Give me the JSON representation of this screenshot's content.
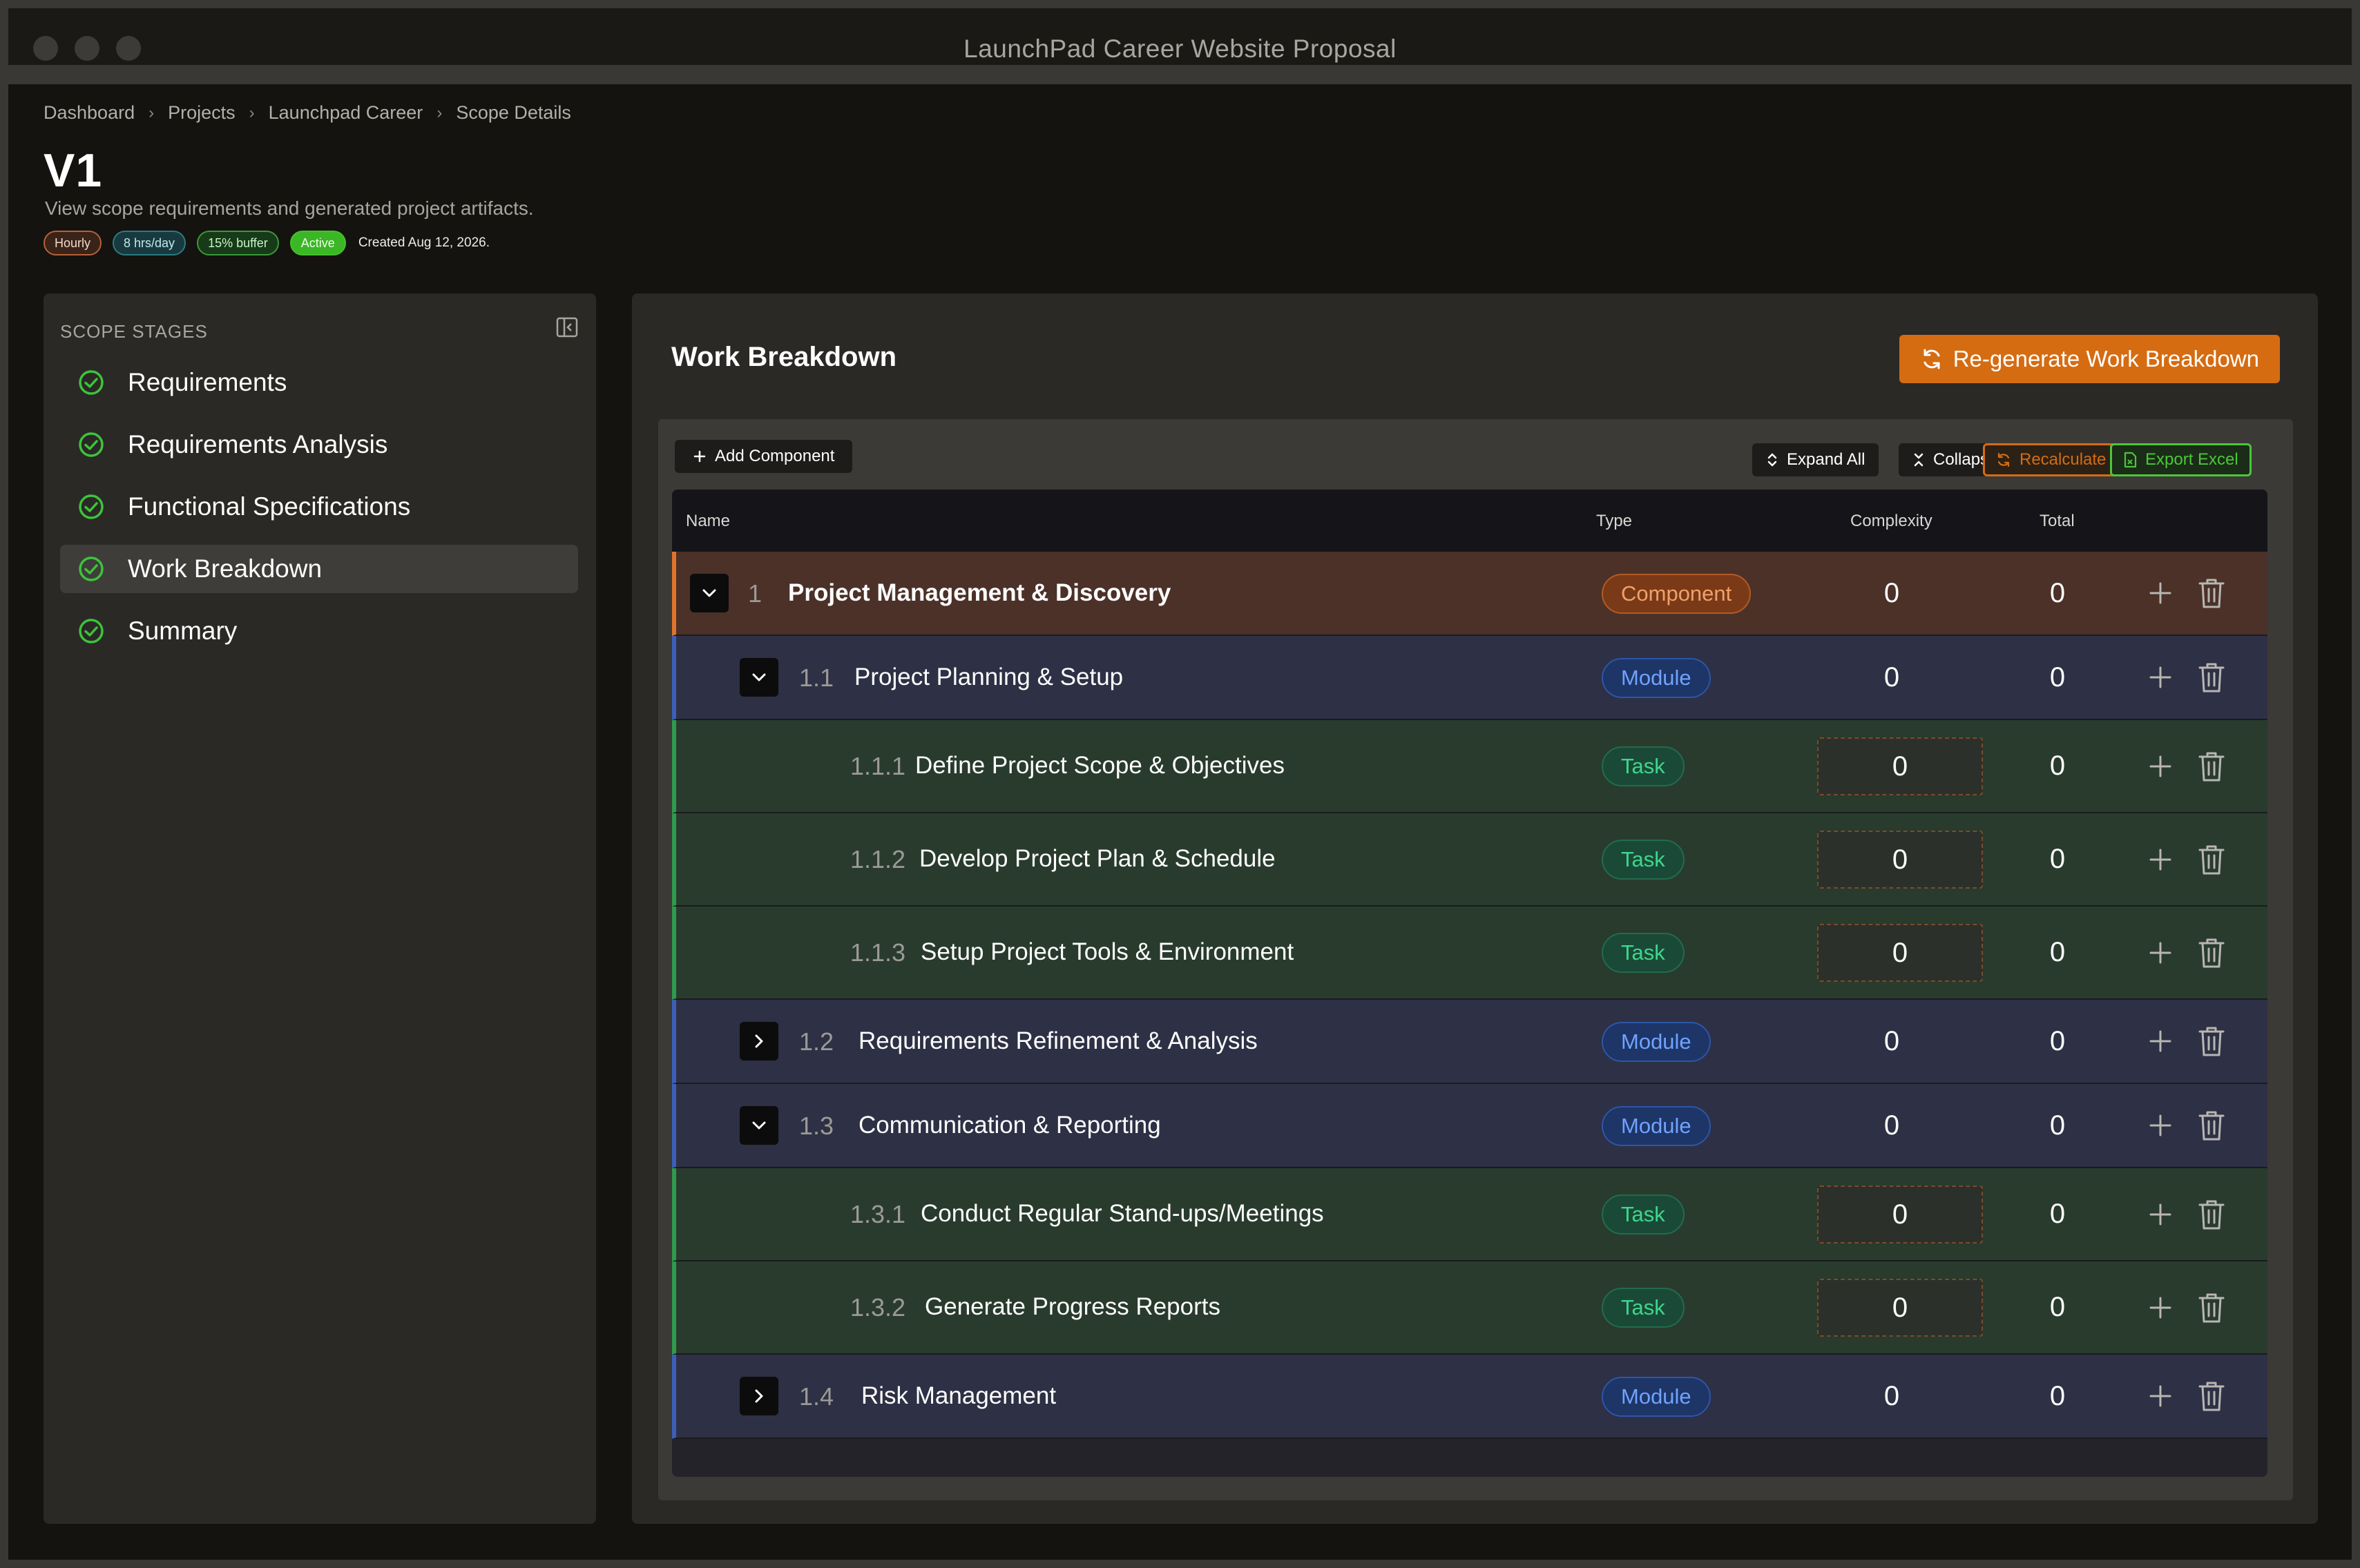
{
  "window": {
    "title": "LaunchPad Career Website Proposal"
  },
  "breadcrumb": [
    "Dashboard",
    "Projects",
    "Launchpad Career",
    "Scope Details"
  ],
  "page": {
    "title": "V1",
    "subtitle": "View scope requirements and generated project artifacts.",
    "badges": [
      "Hourly",
      "8 hrs/day",
      "15% buffer",
      "Active"
    ],
    "created": "Created Aug 12,  2026."
  },
  "sidebar": {
    "heading": "SCOPE STAGES",
    "stages": [
      {
        "label": "Requirements",
        "active": false
      },
      {
        "label": "Requirements Analysis",
        "active": false
      },
      {
        "label": "Functional Specifications",
        "active": false
      },
      {
        "label": "Work Breakdown",
        "active": true
      },
      {
        "label": "Summary",
        "active": false
      }
    ]
  },
  "main": {
    "title": "Work Breakdown",
    "regenerate_label": "Re-generate Work Breakdown",
    "toolbar": {
      "add_component": "Add Component",
      "expand_all": "Expand All",
      "collapse_all": "Collapse All",
      "recalculate": "Recalculate",
      "export_excel": "Export Excel"
    },
    "columns": {
      "name": "Name",
      "type": "Type",
      "complexity": "Complexity",
      "total": "Total"
    },
    "rows": [
      {
        "level": "component",
        "number": "1",
        "name": "Project Management & Discovery",
        "type": "Component",
        "complexity": "0",
        "total": "0",
        "expanded": true
      },
      {
        "level": "module",
        "number": "1.1",
        "name": "Project Planning & Setup",
        "type": "Module",
        "complexity": "0",
        "total": "0",
        "expanded": true
      },
      {
        "level": "task",
        "number": "1.1.1",
        "name": "Define Project Scope & Objectives",
        "type": "Task",
        "complexity": "0",
        "total": "0"
      },
      {
        "level": "task",
        "number": "1.1.2",
        "name": "Develop Project Plan & Schedule",
        "type": "Task",
        "complexity": "0",
        "total": "0"
      },
      {
        "level": "task",
        "number": "1.1.3",
        "name": "Setup Project Tools & Environment",
        "type": "Task",
        "complexity": "0",
        "total": "0"
      },
      {
        "level": "module",
        "number": "1.2",
        "name": "Requirements Refinement & Analysis",
        "type": "Module",
        "complexity": "0",
        "total": "0",
        "expanded": false
      },
      {
        "level": "module",
        "number": "1.3",
        "name": "Communication & Reporting",
        "type": "Module",
        "complexity": "0",
        "total": "0",
        "expanded": true
      },
      {
        "level": "task",
        "number": "1.3.1",
        "name": "Conduct Regular Stand-ups/Meetings",
        "type": "Task",
        "complexity": "0",
        "total": "0"
      },
      {
        "level": "task",
        "number": "1.3.2",
        "name": "Generate Progress Reports",
        "type": "Task",
        "complexity": "0",
        "total": "0"
      },
      {
        "level": "module",
        "number": "1.4",
        "name": "Risk Management",
        "type": "Module",
        "complexity": "0",
        "total": "0",
        "expanded": false
      }
    ]
  },
  "icons": {
    "check": "check-circle-icon",
    "collapse_sidebar": "sidebar-toggle-icon",
    "refresh": "refresh-icon",
    "plus": "plus-icon",
    "trash": "trash-icon",
    "chevron_down": "chevron-down-icon",
    "chevron_right": "chevron-right-icon"
  },
  "colors": {
    "accent_orange": "#d56c12",
    "success_green": "#4cc63a",
    "module_blue": "#6fa3ff",
    "task_green": "#3ed68e"
  }
}
